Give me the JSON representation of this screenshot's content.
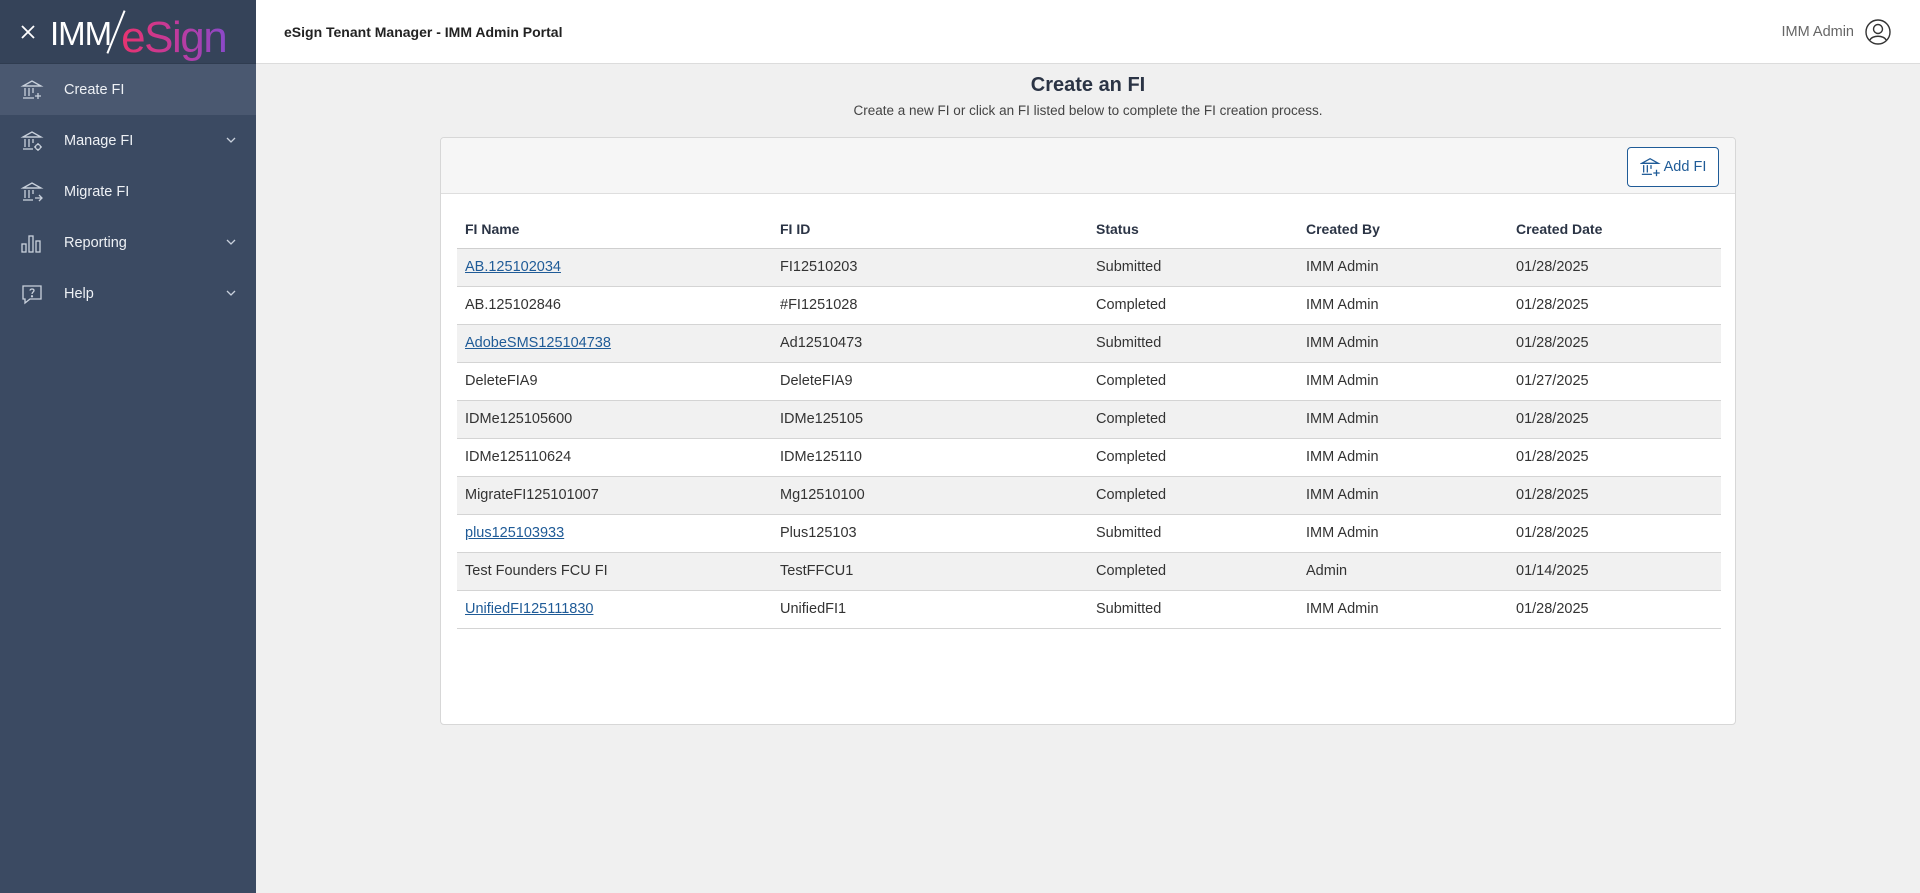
{
  "app": {
    "logo_left": "IMM",
    "logo_right": "eSign",
    "portal_title": "eSign Tenant Manager - IMM Admin Portal",
    "user_name": "IMM Admin"
  },
  "sidebar": {
    "items": [
      {
        "label": "Create FI",
        "icon": "bank-add-icon",
        "active": true,
        "expandable": false
      },
      {
        "label": "Manage FI",
        "icon": "bank-settings-icon",
        "active": false,
        "expandable": true
      },
      {
        "label": "Migrate FI",
        "icon": "bank-migrate-icon",
        "active": false,
        "expandable": false
      },
      {
        "label": "Reporting",
        "icon": "bar-chart-icon",
        "active": false,
        "expandable": true
      },
      {
        "label": "Help",
        "icon": "help-icon",
        "active": false,
        "expandable": true
      }
    ]
  },
  "page": {
    "title": "Create an FI",
    "subtitle": "Create a new FI or click an FI listed below to complete the FI creation process.",
    "add_button": "Add FI"
  },
  "table": {
    "headers": [
      "FI Name",
      "FI ID",
      "Status",
      "Created By",
      "Created Date"
    ],
    "rows": [
      {
        "name": "AB.125102034",
        "id": "FI12510203",
        "status": "Submitted",
        "created_by": "IMM Admin",
        "date": "01/28/2025",
        "link": true
      },
      {
        "name": "AB.125102846",
        "id": "#FI1251028",
        "status": "Completed",
        "created_by": "IMM Admin",
        "date": "01/28/2025",
        "link": false
      },
      {
        "name": "AdobeSMS125104738",
        "id": "Ad12510473",
        "status": "Submitted",
        "created_by": "IMM Admin",
        "date": "01/28/2025",
        "link": true
      },
      {
        "name": "DeleteFIA9",
        "id": "DeleteFIA9",
        "status": "Completed",
        "created_by": "IMM Admin",
        "date": "01/27/2025",
        "link": false
      },
      {
        "name": "IDMe125105600",
        "id": "IDMe125105",
        "status": "Completed",
        "created_by": "IMM Admin",
        "date": "01/28/2025",
        "link": false
      },
      {
        "name": "IDMe125110624",
        "id": "IDMe125110",
        "status": "Completed",
        "created_by": "IMM Admin",
        "date": "01/28/2025",
        "link": false
      },
      {
        "name": "MigrateFI125101007",
        "id": "Mg12510100",
        "status": "Completed",
        "created_by": "IMM Admin",
        "date": "01/28/2025",
        "link": false
      },
      {
        "name": "plus125103933",
        "id": "Plus125103",
        "status": "Submitted",
        "created_by": "IMM Admin",
        "date": "01/28/2025",
        "link": true
      },
      {
        "name": "Test Founders FCU FI",
        "id": "TestFFCU1",
        "status": "Completed",
        "created_by": "Admin",
        "date": "01/14/2025",
        "link": false
      },
      {
        "name": "UnifiedFI125111830",
        "id": "UnifiedFI1",
        "status": "Submitted",
        "created_by": "IMM Admin",
        "date": "01/28/2025",
        "link": true
      }
    ]
  },
  "colors": {
    "sidebar_bg": "#3b4a62",
    "sidebar_active": "#4a5870",
    "link": "#1f5b97",
    "page_bg": "#f0f0f0"
  }
}
